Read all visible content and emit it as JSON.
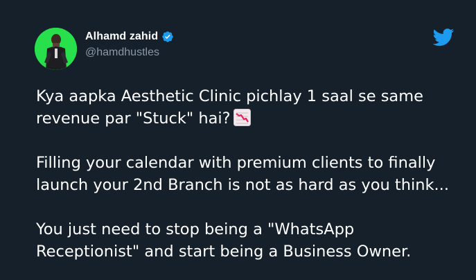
{
  "author": {
    "display_name": "Alhamd zahid",
    "handle": "@hamdhustles",
    "verified": true
  },
  "tweet": {
    "paragraph_1": "Kya aapka Aesthetic Clinic pichlay 1 saal se same revenue par \"Stuck\" hai?",
    "paragraph_1_emoji": "chart-decreasing-icon",
    "paragraph_2": "Filling your calendar with premium clients to finally launch your 2nd Branch is not as hard as you think...",
    "paragraph_3": "You just need to stop being a \"WhatsApp Receptionist\" and start being a Business Owner."
  },
  "icons": {
    "verified": "verified-badge-icon",
    "brand": "twitter-bird-icon"
  },
  "colors": {
    "background": "#15202b",
    "text_primary": "#ffffff",
    "text_secondary": "#8b98a5",
    "twitter_blue": "#1d9bf0",
    "avatar_bg": "#27e04c"
  }
}
